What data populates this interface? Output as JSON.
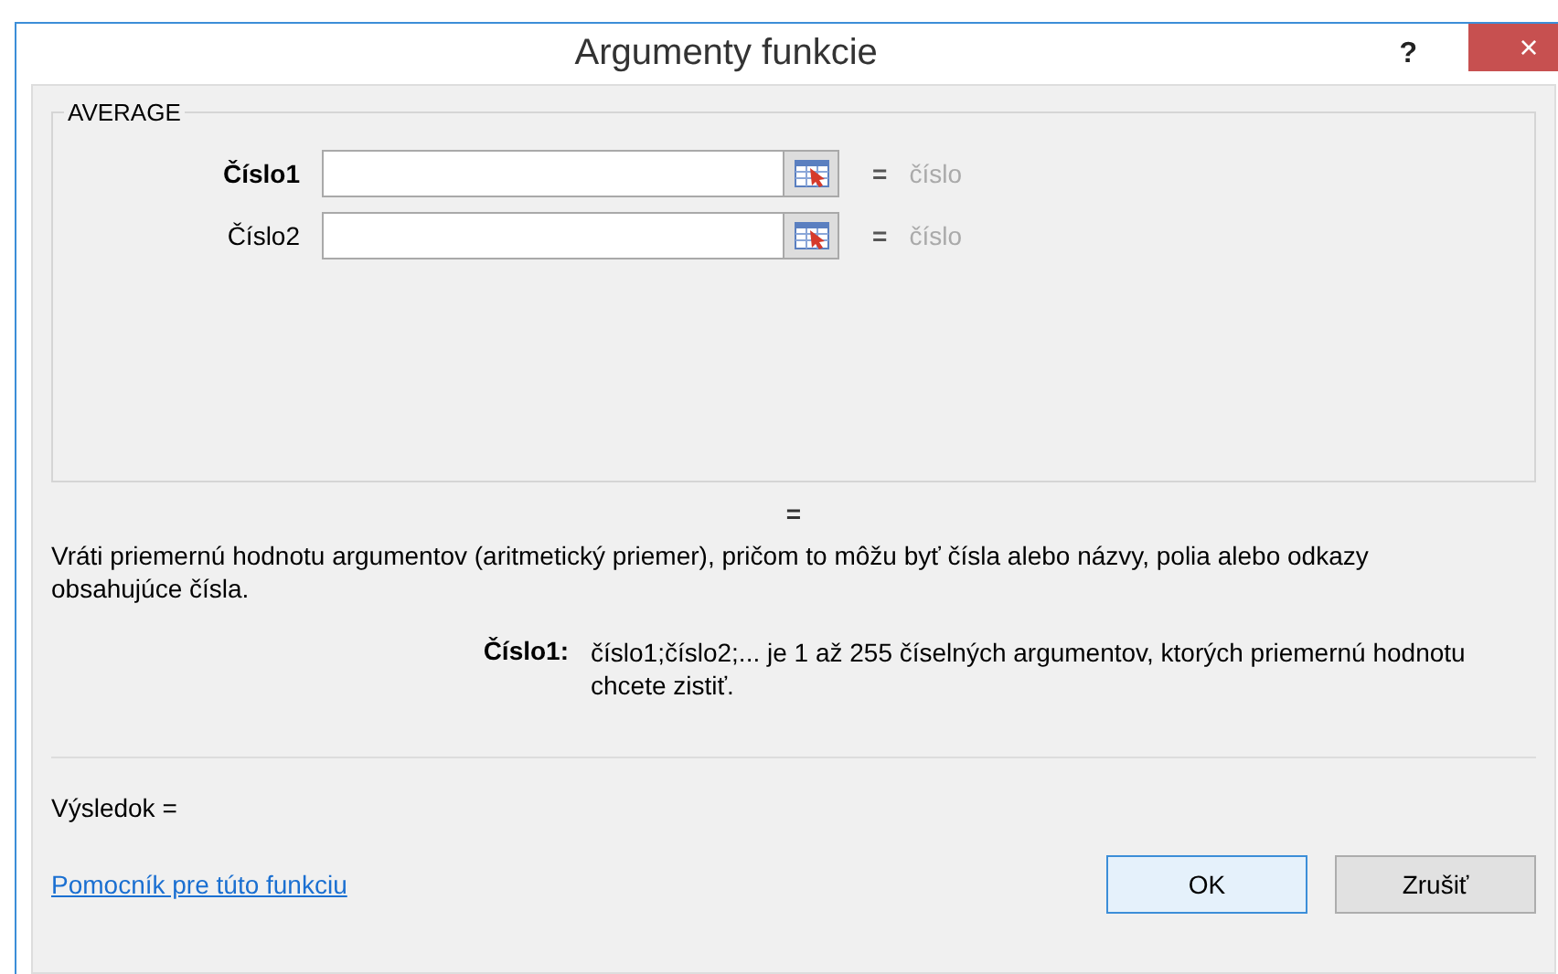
{
  "window": {
    "title": "Argumenty funkcie",
    "help": "?",
    "close": "×"
  },
  "function_name": "AVERAGE",
  "arguments": [
    {
      "label": "Číslo1",
      "selected": true,
      "equals": "=",
      "hint": "číslo"
    },
    {
      "label": "Číslo2",
      "selected": false,
      "equals": "=",
      "hint": "číslo"
    }
  ],
  "formula_result": "=",
  "description": "Vráti priemernú hodnotu argumentov (aritmetický priemer), pričom to môžu byť čísla alebo názvy, polia alebo odkazy obsahujúce čísla.",
  "argument_help": {
    "label": "Číslo1:",
    "text": "číslo1;číslo2;... je 1 až 255 číselných argumentov, ktorých priemernú hodnotu chcete zistiť."
  },
  "result": "Výsledok =",
  "help_link": "Pomocník pre túto funkciu",
  "buttons": [
    {
      "label": "OK",
      "default": true
    },
    {
      "label": "Zrušiť",
      "default": false
    }
  ]
}
